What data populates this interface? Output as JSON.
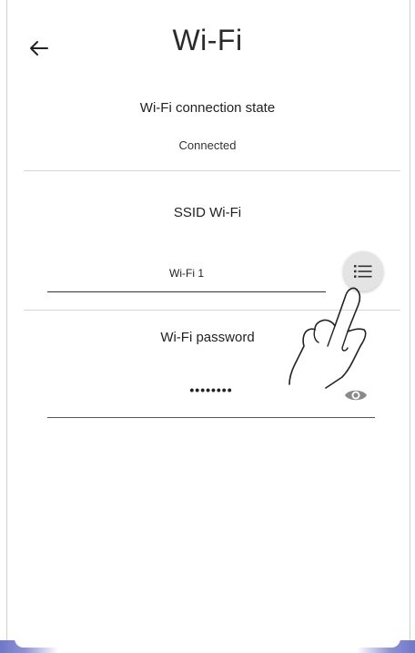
{
  "header": {
    "title": "Wi-Fi",
    "back_icon": "arrow-left-icon"
  },
  "connection": {
    "label": "Wi-Fi connection state",
    "value": "Connected"
  },
  "ssid": {
    "label": "SSID Wi-Fi",
    "value": "Wi-Fi 1",
    "list_icon": "list-icon"
  },
  "password": {
    "label": "Wi-Fi password",
    "value": "••••••••",
    "visibility_icon": "eye-icon"
  },
  "colors": {
    "accent_frame": "#6f77c9",
    "divider": "#d6d6d6",
    "button_bg": "#e4e4e4"
  }
}
